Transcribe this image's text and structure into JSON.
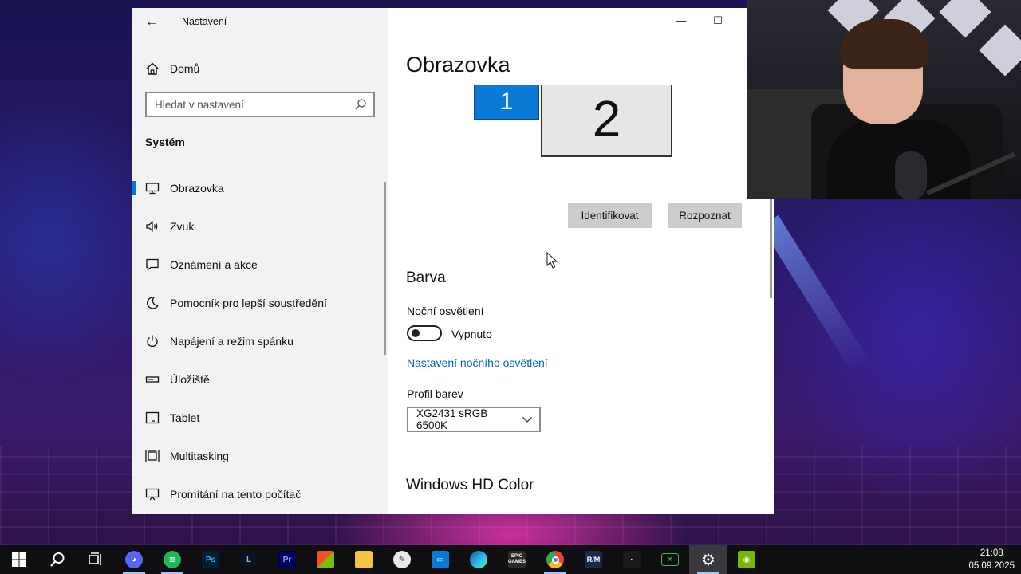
{
  "window": {
    "app_title": "Nastavení",
    "home_label": "Domů",
    "search_placeholder": "Hledat v nastavení",
    "section_title": "Systém",
    "nav_items": [
      {
        "label": "Obrazovka",
        "icon": "monitor-icon"
      },
      {
        "label": "Zvuk",
        "icon": "speaker-icon"
      },
      {
        "label": "Oznámení a akce",
        "icon": "notification-icon"
      },
      {
        "label": "Pomocník pro lepší soustředění",
        "icon": "moon-icon"
      },
      {
        "label": "Napájení a režim spánku",
        "icon": "power-icon"
      },
      {
        "label": "Úložiště",
        "icon": "storage-icon"
      },
      {
        "label": "Tablet",
        "icon": "tablet-icon"
      },
      {
        "label": "Multitasking",
        "icon": "multitasking-icon"
      },
      {
        "label": "Promítání na tento počítač",
        "icon": "projecting-icon"
      }
    ],
    "active_nav": "Obrazovka"
  },
  "content": {
    "page_title": "Obrazovka",
    "monitor_1": "1",
    "monitor_2": "2",
    "identify_button": "Identifikovat",
    "detect_button": "Rozpoznat",
    "color_heading": "Barva",
    "night_light_label": "Noční osvětlení",
    "night_light_state": "Vypnuto",
    "night_light_link": "Nastavení nočního osvětlení",
    "color_profile_label": "Profil barev",
    "color_profile_value": "XG2431 sRGB 6500K",
    "hd_color_heading": "Windows HD Color"
  },
  "taskbar": {
    "items": [
      {
        "name": "windows-start",
        "label": ""
      },
      {
        "name": "search",
        "label": ""
      },
      {
        "name": "task-view",
        "label": ""
      },
      {
        "name": "discord",
        "label": ""
      },
      {
        "name": "spotify",
        "label": ""
      },
      {
        "name": "photoshop",
        "label": "Ps"
      },
      {
        "name": "league-of-legends",
        "label": ""
      },
      {
        "name": "premiere-pro",
        "label": "Pr"
      },
      {
        "name": "microsoft-store",
        "label": ""
      },
      {
        "name": "file-explorer",
        "label": ""
      },
      {
        "name": "paint",
        "label": ""
      },
      {
        "name": "app-blue",
        "label": ""
      },
      {
        "name": "edge",
        "label": ""
      },
      {
        "name": "epic-games",
        "label": "EPIC GAMES"
      },
      {
        "name": "chrome",
        "label": ""
      },
      {
        "name": "rm-app",
        "label": "R/M"
      },
      {
        "name": "app-dark",
        "label": ""
      },
      {
        "name": "xbox-app",
        "label": ""
      },
      {
        "name": "settings",
        "label": ""
      },
      {
        "name": "nvidia",
        "label": ""
      }
    ],
    "time": "21:08",
    "date": "05.09.2025"
  },
  "colors": {
    "accent": "#0078d7",
    "link": "#0067b8",
    "sidebar_bg": "#f2f2f2",
    "taskbar_bg": "#0f0f12"
  }
}
